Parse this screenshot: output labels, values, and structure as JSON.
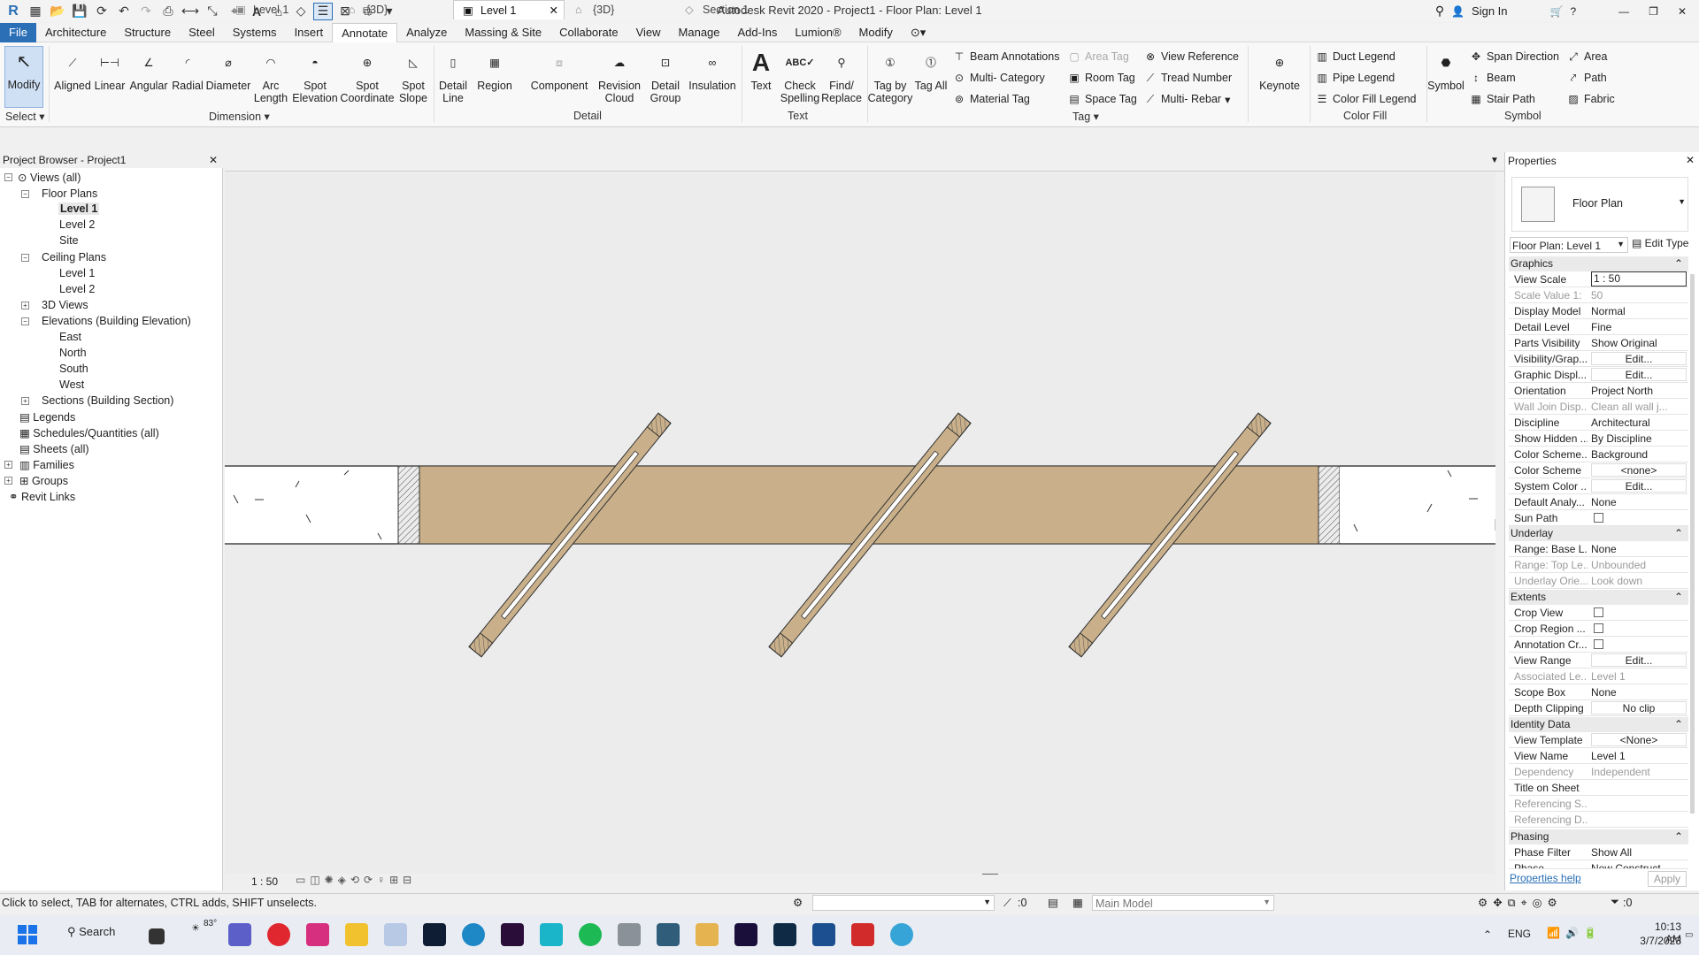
{
  "window": {
    "title": "Autodesk Revit 2020 - Project1 - Floor Plan: Level 1",
    "sign_in": "Sign In"
  },
  "menu": [
    "File",
    "Architecture",
    "Structure",
    "Steel",
    "Systems",
    "Insert",
    "Annotate",
    "Analyze",
    "Massing & Site",
    "Collaborate",
    "View",
    "Manage",
    "Add-Ins",
    "Lumion®",
    "Modify"
  ],
  "ribbon": {
    "modify": "Modify",
    "select": "Select",
    "dimension": {
      "aligned": "Aligned",
      "linear": "Linear",
      "angular": "Angular",
      "radial": "Radial",
      "diameter": "Diameter",
      "arc_length": "Arc Length",
      "spot_elevation": "Spot Elevation",
      "spot_coordinate": "Spot Coordinate",
      "spot_slope": "Spot Slope",
      "group": "Dimension"
    },
    "detail": {
      "detail_line": "Detail Line",
      "region": "Region",
      "component": "Component",
      "revision_cloud": "Revision Cloud",
      "detail_group": "Detail Group",
      "insulation": "Insulation",
      "group": "Detail"
    },
    "text": {
      "text": "Text",
      "check_spelling": "Check Spelling",
      "find_replace": "Find/ Replace",
      "group": "Text"
    },
    "tag": {
      "tag_by_category": "Tag by Category",
      "tag_all": "Tag All",
      "beam_annotations": "Beam Annotations",
      "multi_category": "Multi- Category",
      "material_tag": "Material Tag",
      "area_tag": "Area Tag",
      "room_tag": "Room Tag",
      "space_tag": "Space Tag",
      "view_reference": "View Reference",
      "tread_number": "Tread Number",
      "multi_rebar": "Multi- Rebar",
      "keynote": "Keynote",
      "group": "Tag"
    },
    "color_fill": {
      "duct_legend": "Duct Legend",
      "pipe_legend": "Pipe Legend",
      "color_fill_legend": "Color Fill Legend",
      "group": "Color Fill"
    },
    "symbol": {
      "symbol": "Symbol",
      "span_direction": "Span Direction",
      "beam": "Beam",
      "stair_path": "Stair Path",
      "area": "Area",
      "path": "Path",
      "fabric": "Fabric",
      "group": "Symbol"
    }
  },
  "project_browser": {
    "title": "Project Browser - Project1",
    "views_all": "Views (all)",
    "floor_plans": "Floor Plans",
    "fp_level1": "Level 1",
    "fp_level2": "Level 2",
    "fp_site": "Site",
    "ceiling_plans": "Ceiling Plans",
    "cp_level1": "Level 1",
    "cp_level2": "Level 2",
    "views_3d": "3D Views",
    "elevations": "Elevations (Building Elevation)",
    "east": "East",
    "north": "North",
    "south": "South",
    "west": "West",
    "sections": "Sections (Building Section)",
    "legends": "Legends",
    "schedules": "Schedules/Quantities (all)",
    "sheets": "Sheets (all)",
    "families": "Families",
    "groups": "Groups",
    "revit_links": "Revit Links"
  },
  "tabs": [
    "Level 1",
    "{3D}",
    "Level 1",
    "{3D}",
    "Section 1"
  ],
  "view_scale_label": "1 : 50",
  "properties": {
    "title": "Properties",
    "type": "Floor Plan",
    "selector": "Floor Plan: Level 1",
    "edit_type": "Edit Type",
    "sections": {
      "graphics": "Graphics",
      "underlay": "Underlay",
      "extents": "Extents",
      "identity": "Identity Data",
      "phasing": "Phasing"
    },
    "graphics": [
      {
        "k": "View Scale",
        "v": "1 : 50"
      },
      {
        "k": "Scale Value    1:",
        "v": "50"
      },
      {
        "k": "Display Model",
        "v": "Normal"
      },
      {
        "k": "Detail Level",
        "v": "Fine"
      },
      {
        "k": "Parts Visibility",
        "v": "Show Original"
      },
      {
        "k": "Visibility/Grap...",
        "v": "Edit..."
      },
      {
        "k": "Graphic Displ...",
        "v": "Edit..."
      },
      {
        "k": "Orientation",
        "v": "Project North"
      },
      {
        "k": "Wall Join Disp...",
        "v": "Clean all wall j..."
      },
      {
        "k": "Discipline",
        "v": "Architectural"
      },
      {
        "k": "Show Hidden ...",
        "v": "By Discipline"
      },
      {
        "k": "Color Scheme...",
        "v": "Background"
      },
      {
        "k": "Color Scheme",
        "v": "<none>"
      },
      {
        "k": "System Color ...",
        "v": "Edit..."
      },
      {
        "k": "Default Analy...",
        "v": "None"
      },
      {
        "k": "Sun Path",
        "v": ""
      }
    ],
    "underlay": [
      {
        "k": "Range: Base L...",
        "v": "None"
      },
      {
        "k": "Range: Top Le...",
        "v": "Unbounded"
      },
      {
        "k": "Underlay Orie...",
        "v": "Look down"
      }
    ],
    "extents": [
      {
        "k": "Crop View",
        "v": ""
      },
      {
        "k": "Crop Region ...",
        "v": ""
      },
      {
        "k": "Annotation Cr...",
        "v": ""
      },
      {
        "k": "View Range",
        "v": "Edit..."
      },
      {
        "k": "Associated Le...",
        "v": "Level 1"
      },
      {
        "k": "Scope Box",
        "v": "None"
      },
      {
        "k": "Depth Clipping",
        "v": "No clip"
      }
    ],
    "identity": [
      {
        "k": "View Template",
        "v": "<None>"
      },
      {
        "k": "View Name",
        "v": "Level 1"
      },
      {
        "k": "Dependency",
        "v": "Independent"
      },
      {
        "k": "Title on Sheet",
        "v": ""
      },
      {
        "k": "Referencing S...",
        "v": ""
      },
      {
        "k": "Referencing D...",
        "v": ""
      }
    ],
    "phasing": [
      {
        "k": "Phase Filter",
        "v": "Show All"
      },
      {
        "k": "Phase",
        "v": "New Construct..."
      }
    ],
    "help": "Properties help",
    "apply": "Apply"
  },
  "status": {
    "hint": "Click to select, TAB for alternates, CTRL adds, SHIFT unselects.",
    "count": ":0",
    "model": "Main Model",
    "filter": ":0"
  },
  "taskbar": {
    "search": "Search",
    "temp": "83°",
    "lang": "ENG",
    "time": "10:13 AM",
    "date": "3/7/2023"
  }
}
